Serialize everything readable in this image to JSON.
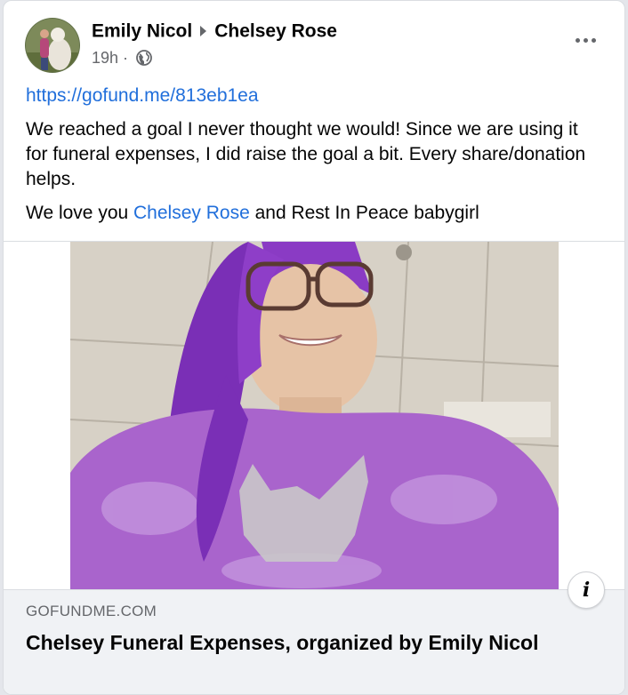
{
  "post": {
    "author": "Emily Nicol",
    "recipient": "Chelsey Rose",
    "timestamp": "19h",
    "audience_icon": "globe-icon",
    "more_icon": "more-options-icon"
  },
  "content": {
    "url": "https://gofund.me/813eb1ea",
    "paragraph": "We reached a goal I never thought we would! Since we are using it for funeral expenses, I did raise the goal a bit. Every share/donation helps.",
    "line2_prefix": "We love you ",
    "line2_mention": "Chelsey Rose",
    "line2_suffix": " and Rest In Peace babygirl"
  },
  "preview": {
    "domain": "GOFUNDME.COM",
    "title": "Chelsey Funeral Expenses, organized by Emily Nicol",
    "info_icon": "info-icon"
  },
  "colors": {
    "link": "#216fdb",
    "secondary_text": "#65676b",
    "preview_bg": "#f0f2f5"
  }
}
